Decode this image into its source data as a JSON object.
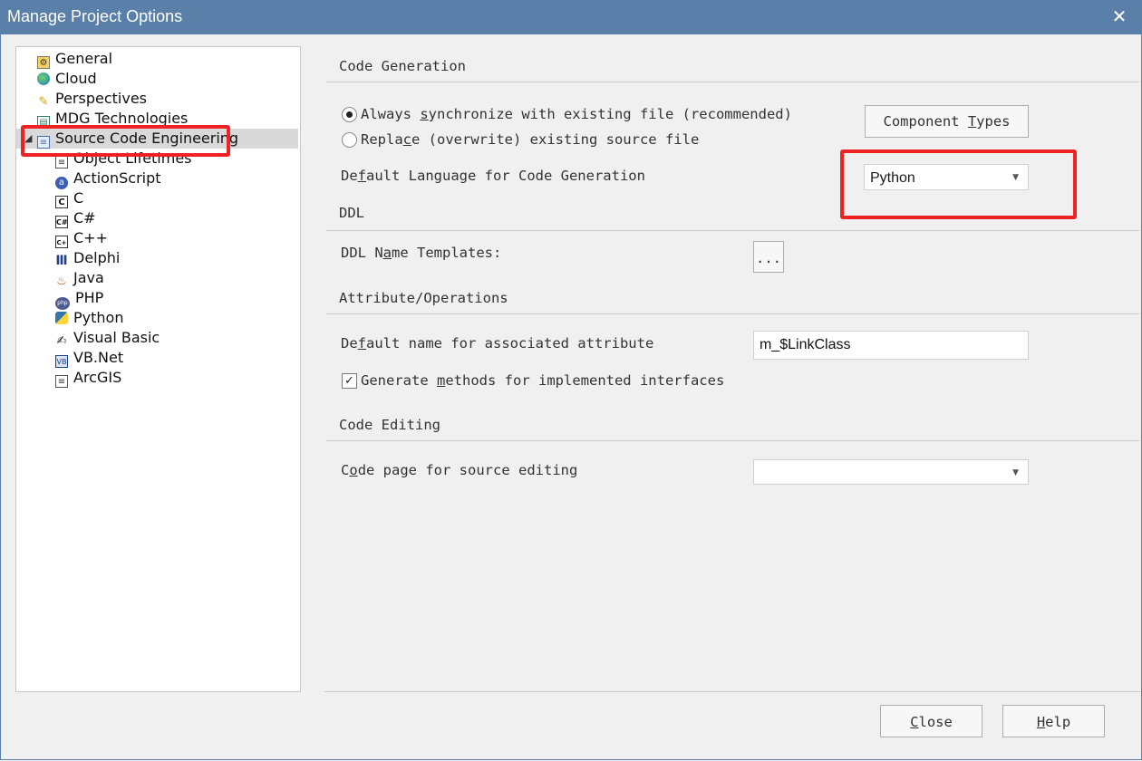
{
  "window": {
    "title": "Manage Project Options",
    "close_glyph": "✕"
  },
  "tree": {
    "items": [
      {
        "label": "General",
        "icon": "general-icon",
        "level": 0
      },
      {
        "label": "Cloud",
        "icon": "cloud-icon",
        "level": 0
      },
      {
        "label": "Perspectives",
        "icon": "perspectives-icon",
        "level": 0
      },
      {
        "label": "MDG Technologies",
        "icon": "mdg-icon",
        "level": 0
      },
      {
        "label": "Source Code Engineering",
        "icon": "source-code-icon",
        "level": 0,
        "selected": true,
        "expanded": true
      },
      {
        "label": "Object Lifetimes",
        "icon": "document-icon",
        "level": 1
      },
      {
        "label": "ActionScript",
        "icon": "actionscript-icon",
        "level": 1
      },
      {
        "label": "C",
        "icon": "c-icon",
        "level": 1
      },
      {
        "label": "C#",
        "icon": "csharp-icon",
        "level": 1
      },
      {
        "label": "C++",
        "icon": "cpp-icon",
        "level": 1
      },
      {
        "label": "Delphi",
        "icon": "delphi-icon",
        "level": 1
      },
      {
        "label": "Java",
        "icon": "java-icon",
        "level": 1
      },
      {
        "label": "PHP",
        "icon": "php-icon",
        "level": 1
      },
      {
        "label": "Python",
        "icon": "python-icon",
        "level": 1
      },
      {
        "label": "Visual Basic",
        "icon": "visual-basic-icon",
        "level": 1
      },
      {
        "label": "VB.Net",
        "icon": "vbnet-icon",
        "level": 1
      },
      {
        "label": "ArcGIS",
        "icon": "arcgis-icon",
        "level": 1
      }
    ]
  },
  "sections": {
    "code_generation": "Code Generation",
    "ddl": "DDL",
    "attribute_operations": "Attribute/Operations",
    "code_editing": "Code Editing"
  },
  "code_generation": {
    "radio_sync": {
      "pre": "Always ",
      "u": "s",
      "post": "ynchronize with existing file (recommended)",
      "checked": true
    },
    "radio_replace": {
      "pre": "Repla",
      "u": "c",
      "post": "e (overwrite) existing source file",
      "checked": false
    },
    "component_types": {
      "pre": "Component ",
      "u": "T",
      "post": "ypes"
    },
    "default_language": {
      "pre": "De",
      "u": "f",
      "post": "ault Language for Code Generation"
    },
    "default_language_value": "Python"
  },
  "ddl": {
    "name_templates": {
      "pre": "DDL N",
      "u": "a",
      "post": "me Templates:"
    },
    "browse_label": "..."
  },
  "attribute": {
    "default_name": {
      "pre": "De",
      "u": "f",
      "post": "ault name for associated attribute"
    },
    "default_name_value": "m_$LinkClass",
    "generate_methods": {
      "pre": "Generate ",
      "u": "m",
      "post": "ethods for implemented interfaces",
      "checked": true
    }
  },
  "code_editing": {
    "code_page": {
      "pre": "C",
      "u": "o",
      "post": "de page for source editing"
    },
    "code_page_value": ""
  },
  "footer": {
    "close": {
      "pre": "",
      "u": "C",
      "post": "lose"
    },
    "help": {
      "pre": "",
      "u": "H",
      "post": "elp"
    }
  },
  "colors": {
    "titlebar": "#5a7fa8",
    "highlight": "#ee2222",
    "selection": "#d9d9d9"
  }
}
